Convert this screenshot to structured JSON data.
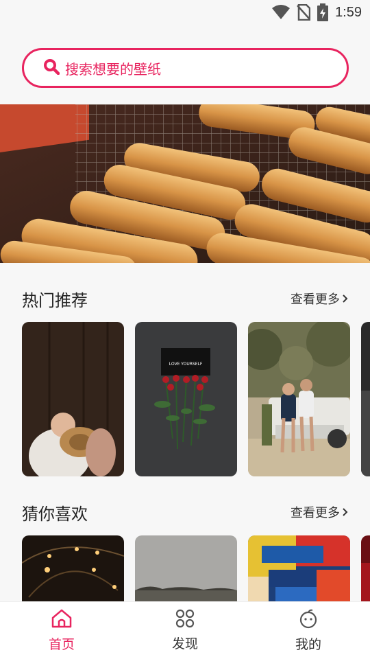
{
  "status_bar": {
    "time": "1:59",
    "icons": [
      "wifi-icon",
      "no-sim-icon",
      "battery-charging-icon"
    ]
  },
  "search": {
    "placeholder": "搜索想要的壁纸",
    "icon": "search-icon"
  },
  "banner": {
    "image": "spring-rolls-on-grill-photo"
  },
  "sections": [
    {
      "title": "热门推荐",
      "more_label": "查看更多",
      "cards": [
        "couple-hat-photo",
        "love-yourself-roses-photo",
        "couple-truck-photo",
        "partial-card-photo"
      ]
    },
    {
      "title": "猜你喜欢",
      "more_label": "查看更多",
      "cards": [
        "string-lights-photo",
        "grey-landscape-photo",
        "comic-covers-photo",
        "partial-red-photo"
      ]
    }
  ],
  "rose_card_text": "LOVE YOURSELF",
  "bottom_nav": {
    "items": [
      {
        "label": "首页",
        "icon": "home-icon",
        "active": true
      },
      {
        "label": "发现",
        "icon": "discover-icon",
        "active": false
      },
      {
        "label": "我的",
        "icon": "profile-icon",
        "active": false
      }
    ]
  },
  "colors": {
    "accent": "#e8245f",
    "background": "#f7f7f7"
  }
}
